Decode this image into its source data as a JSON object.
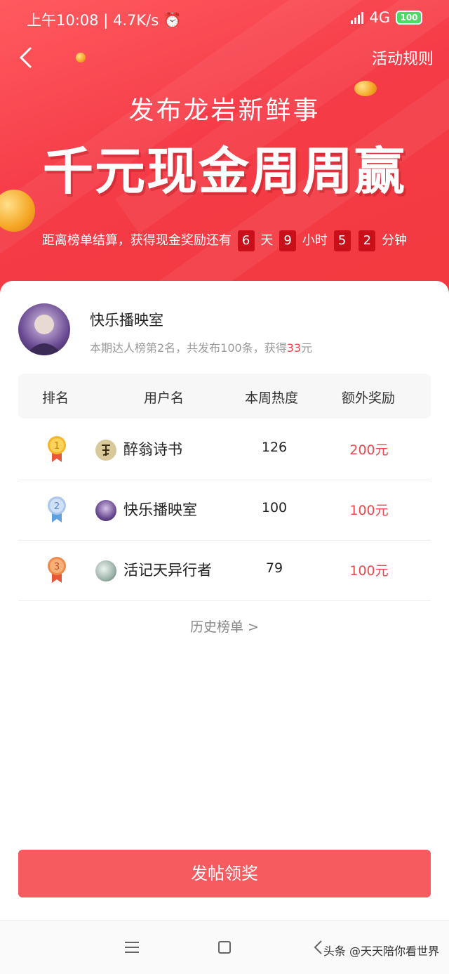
{
  "status_bar": {
    "time": "上午10:08",
    "speed": "4.7K/s",
    "network": "4G",
    "battery": "100"
  },
  "header": {
    "rules_label": "活动规则"
  },
  "banner": {
    "subtitle": "发布龙岩新鲜事",
    "headline": "千元现金周周赢",
    "countdown_prefix": "距离榜单结算，获得现金奖励还有",
    "days": "6",
    "days_unit": "天",
    "hours": "9",
    "hours_unit": "小时",
    "minutes_tens": "5",
    "minutes_ones": "2",
    "minutes_unit": "分钟"
  },
  "me": {
    "name": "快乐播映室",
    "desc_prefix": "本期达人榜第2名，共发布100条，获得",
    "amount": "33",
    "amount_unit": "元"
  },
  "table": {
    "headers": [
      "排名",
      "用户名",
      "本周热度",
      "额外奖励"
    ],
    "rows": [
      {
        "rank": "1",
        "name": "醉翁诗书",
        "heat": "126",
        "reward": "200元"
      },
      {
        "rank": "2",
        "name": "快乐播映室",
        "heat": "100",
        "reward": "100元"
      },
      {
        "rank": "3",
        "name": "活记天异行者",
        "heat": "79",
        "reward": "100元"
      }
    ]
  },
  "history_label": "历史榜单 >",
  "post_button_label": "发帖领奖",
  "watermark": "头条 @天天陪你看世界",
  "colors": {
    "banner_red": "#f53b47",
    "accent_red": "#e84a4f",
    "button_red": "#f55b5f",
    "gold": "#f5a623",
    "silver": "#8fb8e8",
    "bronze": "#f08a4b"
  }
}
